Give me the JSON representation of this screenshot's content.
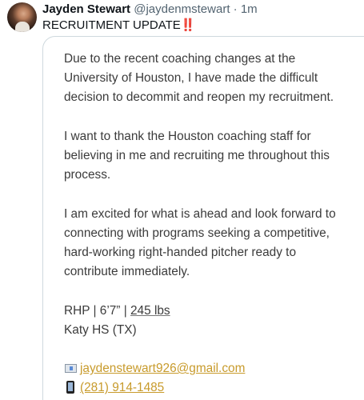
{
  "author": {
    "name": "Jayden Stewart",
    "handle": "@jaydenmstewart",
    "separator": "·",
    "time": "1m"
  },
  "tweet": {
    "text": "RECRUITMENT UPDATE",
    "emoji": "‼️"
  },
  "card": {
    "p1": [
      "Due to the recent coaching changes at the",
      "University of Houston, I have made the difficult",
      "decision to decommit and reopen my recruitment."
    ],
    "p2": [
      "I want to thank the Houston coaching staff for",
      "believing in me and recruiting me throughout this",
      "process."
    ],
    "p3": [
      "I am excited for what is ahead and look forward to",
      "connecting with programs seeking a competitive,",
      "hard-working right-handed pitcher ready to",
      "contribute immediately."
    ],
    "stats_prefix": "RHP | 6’7” | ",
    "stats_weight": "245 lbs",
    "school": "Katy HS (TX)",
    "email": "jaydenstewart926@gmail.com",
    "phone": "(281) 914-1485",
    "email_icon": "envelope-icon",
    "phone_icon": "mobile-phone-icon"
  }
}
